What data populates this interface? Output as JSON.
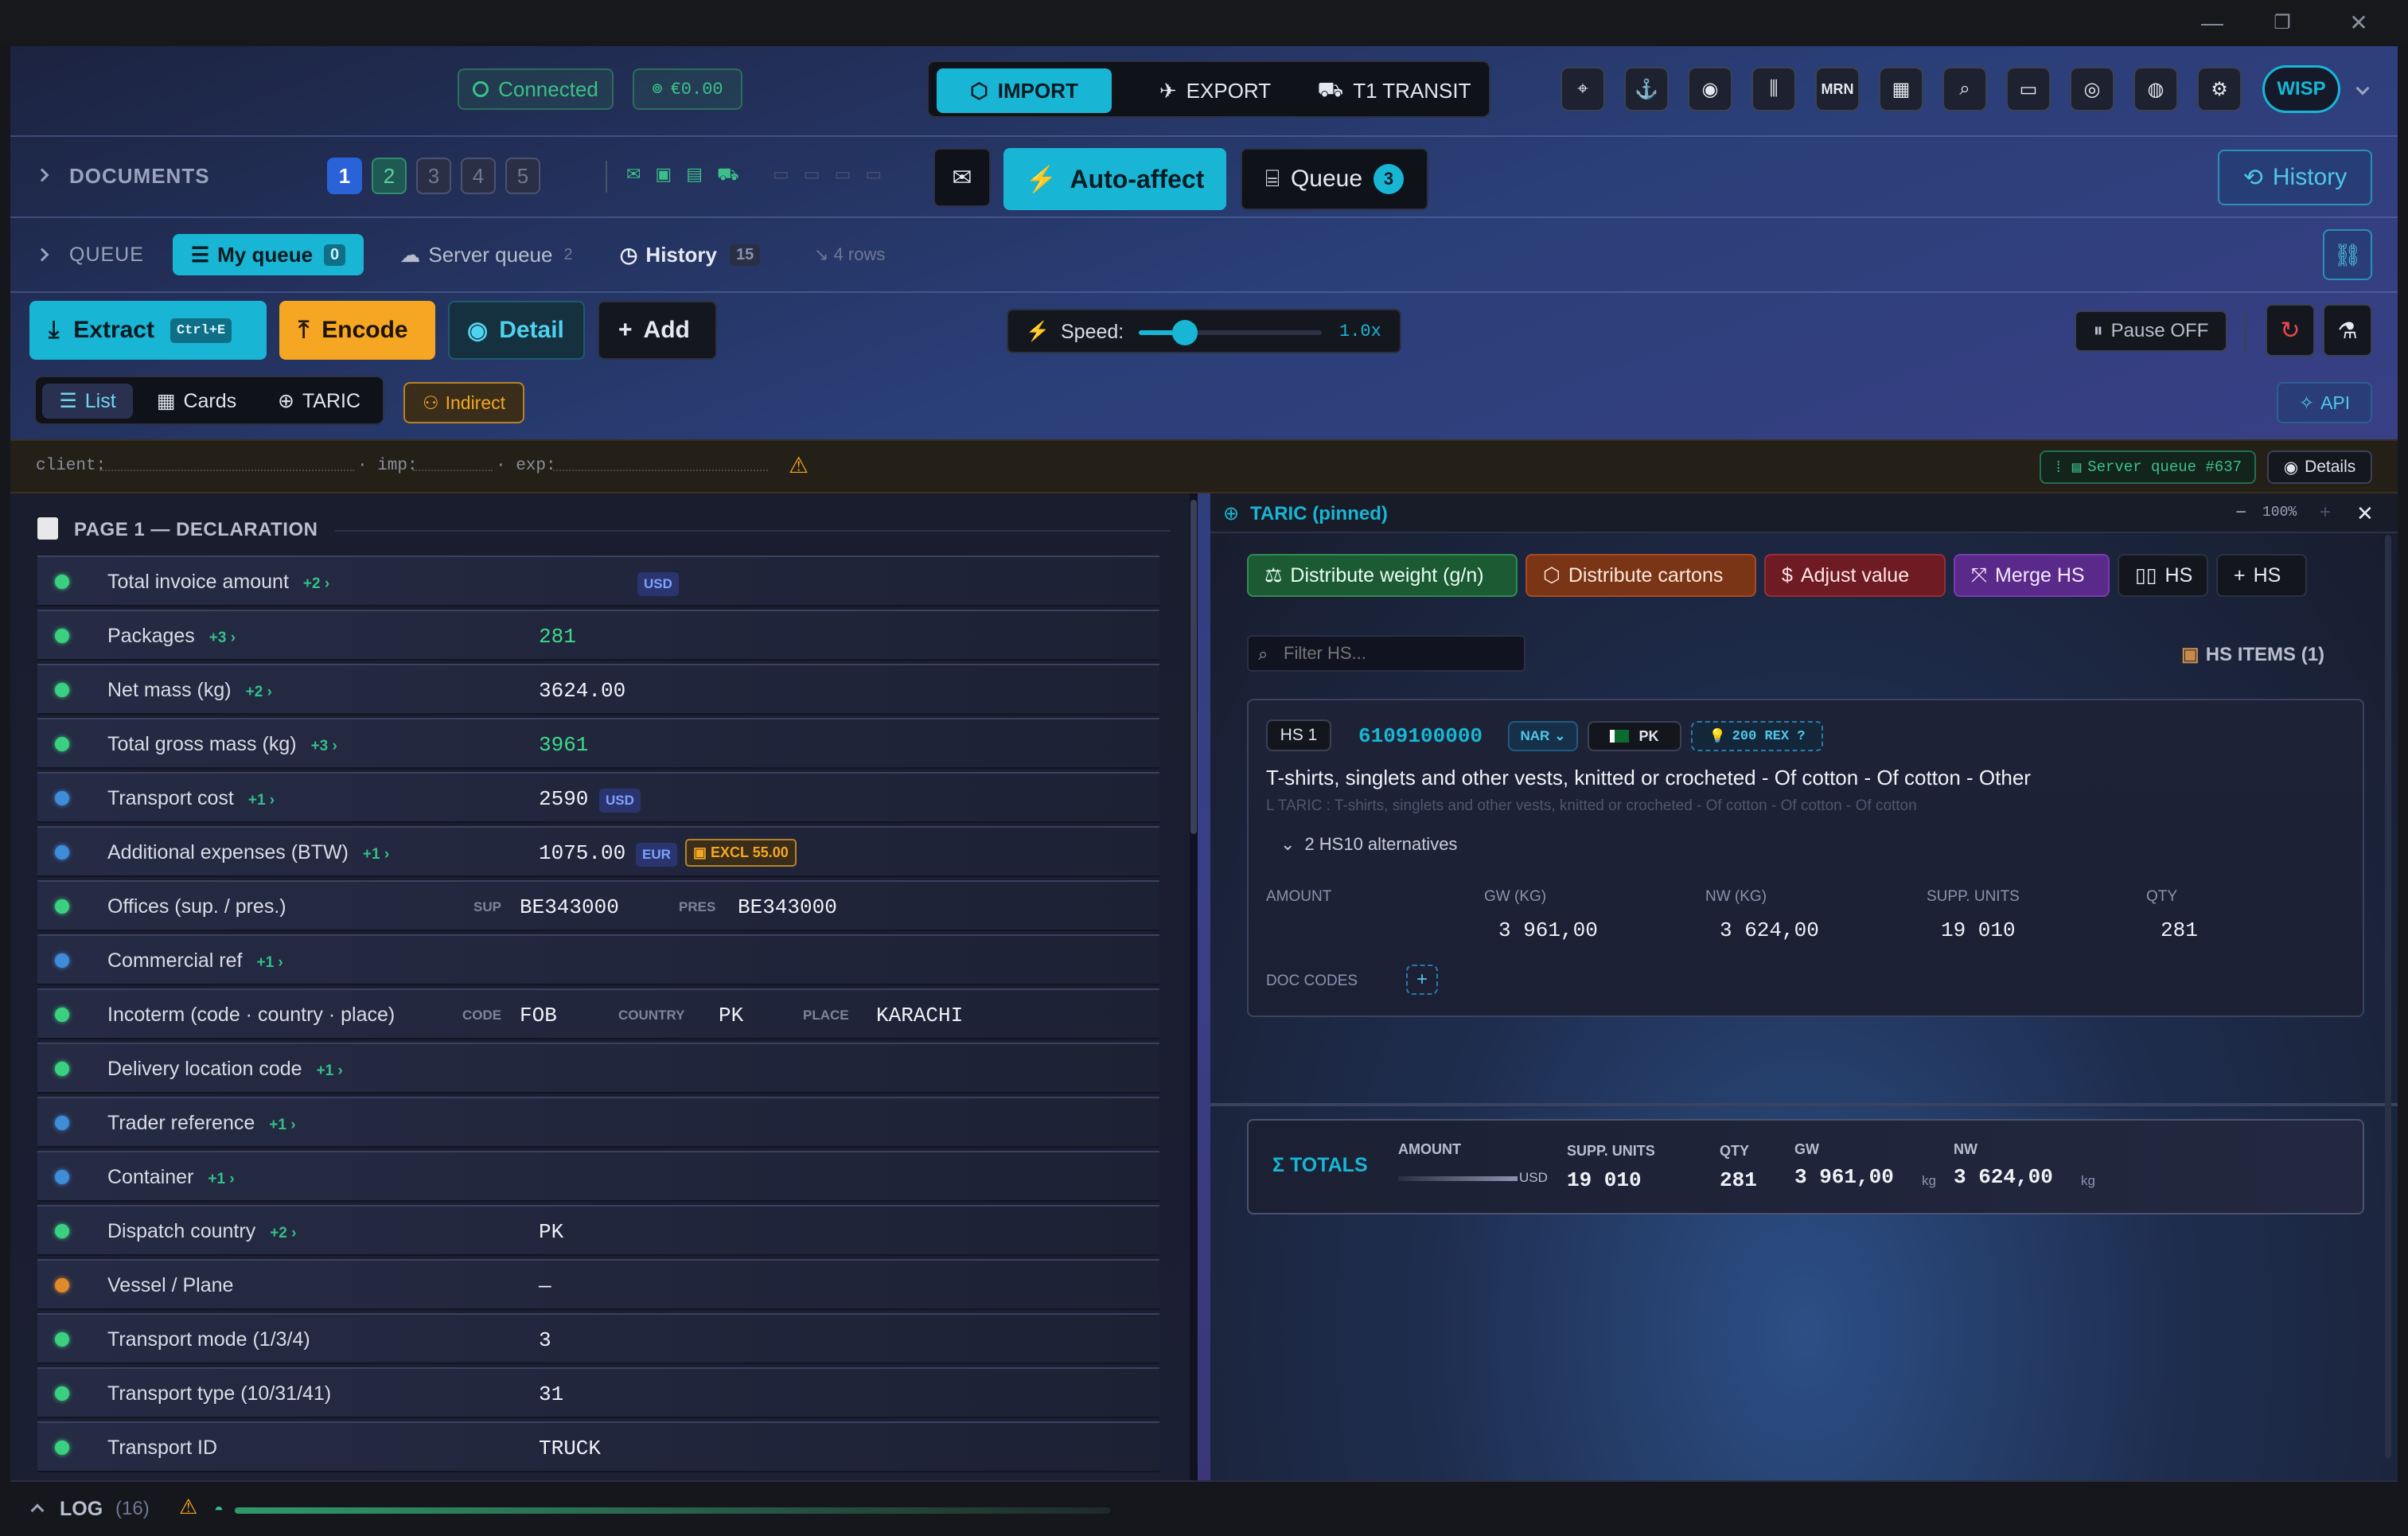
{
  "titlebar": {
    "minimize": "—",
    "restore": "❐",
    "close": "✕"
  },
  "header": {
    "connected": "Connected",
    "balance": "€0.00",
    "modes": [
      "IMPORT",
      "EXPORT",
      "T1 TRANSIT"
    ],
    "icons": [
      "crosshair-icon",
      "hook-icon",
      "eye-icon",
      "columns-icon",
      "mrn-badge",
      "calculator-icon",
      "search-icon",
      "id-card-icon",
      "fingerprint-icon",
      "palette-icon",
      "gear-icon"
    ],
    "mrn": "MRN",
    "user": "WISP"
  },
  "documents": {
    "label": "DOCUMENTS",
    "pages": [
      "1",
      "2",
      "3",
      "4",
      "5"
    ],
    "auto_affect": "Auto-affect",
    "queue": "Queue",
    "queue_count": "3",
    "history": "History"
  },
  "queue_bar": {
    "label": "QUEUE",
    "my_queue": "My queue",
    "my_queue_count": "0",
    "server_queue": "Server queue",
    "server_queue_count": "2",
    "history": "History",
    "history_count": "15",
    "rows": "4 rows"
  },
  "toolbar": {
    "extract": "Extract",
    "extract_shortcut": "Ctrl+E",
    "encode": "Encode",
    "detail": "Detail",
    "add": "Add",
    "speed_label": "Speed:",
    "speed_value": "1.0x",
    "speed_fraction": 0.25,
    "pause": "Pause OFF"
  },
  "view_tabs": {
    "list": "List",
    "cards": "Cards",
    "taric": "TARIC",
    "indirect": "Indirect",
    "api": "API"
  },
  "infobar": {
    "client": "client:",
    "imp": "· imp:",
    "exp": "· exp:",
    "server_queue": "Server queue #637",
    "details": "Details"
  },
  "declaration": {
    "title": "PAGE 1 — DECLARATION",
    "rows": [
      {
        "label": "Total invoice amount",
        "plus": "+2 ›",
        "dot": "#3bd07f",
        "value": "",
        "unit": "USD"
      },
      {
        "label": "Packages",
        "plus": "+3 ›",
        "dot": "#3bd07f",
        "value": "281",
        "green": true
      },
      {
        "label": "Net mass (kg)",
        "plus": "+2 ›",
        "dot": "#3bd07f",
        "value": "3624.00"
      },
      {
        "label": "Total gross mass (kg)",
        "plus": "+3 ›",
        "dot": "#3bd07f",
        "value": "3961",
        "green": true
      },
      {
        "label": "Transport cost",
        "plus": "+1 ›",
        "dot": "#3f8cd8",
        "value": "2590",
        "unit": "USD"
      },
      {
        "label": "Additional expenses (BTW)",
        "plus": "+1 ›",
        "dot": "#3f8cd8",
        "value": "1075.00",
        "unit": "EUR",
        "excl": "EXCL 55.00"
      },
      {
        "label": "Offices (sup. / pres.)",
        "plus": "",
        "dot": "#3bd07f",
        "offices": {
          "sup_label": "SUP",
          "sup": "BE343000",
          "pres_label": "PRES",
          "pres": "BE343000"
        }
      },
      {
        "label": "Commercial ref",
        "plus": "+1 ›",
        "dot": "#3f8cd8",
        "value": ""
      },
      {
        "label": "Incoterm (code · country · place)",
        "plus": "",
        "dot": "#3bd07f",
        "incoterm": {
          "code_label": "CODE",
          "code": "FOB",
          "country_label": "COUNTRY",
          "country": "PK",
          "place_label": "PLACE",
          "place": "KARACHI"
        }
      },
      {
        "label": "Delivery location code",
        "plus": "+1 ›",
        "dot": "#3bd07f",
        "value": ""
      },
      {
        "label": "Trader reference",
        "plus": "+1 ›",
        "dot": "#3f8cd8",
        "value": ""
      },
      {
        "label": "Container",
        "plus": "+1 ›",
        "dot": "#3f8cd8",
        "value": ""
      },
      {
        "label": "Dispatch country",
        "plus": "+2 ›",
        "dot": "#3bd07f",
        "value": "PK"
      },
      {
        "label": "Vessel / Plane",
        "plus": "",
        "dot": "#e08a2a",
        "value": "—"
      },
      {
        "label": "Transport mode (1/3/4)",
        "plus": "",
        "dot": "#3bd07f",
        "value": "3"
      },
      {
        "label": "Transport type (10/31/41)",
        "plus": "",
        "dot": "#3bd07f",
        "value": "31"
      },
      {
        "label": "Transport ID",
        "plus": "",
        "dot": "#3bd07f",
        "value": "TRUCK"
      }
    ]
  },
  "taric": {
    "title": "TARIC (pinned)",
    "zoom": "100%",
    "actions": {
      "distribute_weight": "Distribute weight (g/n)",
      "distribute_cartons": "Distribute cartons",
      "adjust_value": "Adjust value",
      "merge_hs": "Merge HS",
      "hs": "HS",
      "add_hs": "HS"
    },
    "filter_placeholder": "Filter HS...",
    "items_label": "HS ITEMS (1)",
    "item": {
      "hs_label": "HS 1",
      "code": "6109100000",
      "nar": "NAR",
      "country": "PK",
      "rex": "200 REX ?",
      "description": "T-shirts, singlets and other vests, knitted or crocheted - Of cotton - Of cotton - Other",
      "taric_desc": "L TARIC : T-shirts, singlets and other vests, knitted or crocheted - Of cotton - Of cotton - Of cotton",
      "alternatives": "2 HS10 alternatives",
      "col_amount": "AMOUNT",
      "col_gw": "GW (KG)",
      "col_nw": "NW (KG)",
      "col_supp": "SUPP. UNITS",
      "col_qty": "QTY",
      "gw": "3 961,00",
      "nw": "3 624,00",
      "supp": "19 010",
      "qty": "281",
      "doc_codes": "DOC CODES"
    },
    "totals": {
      "label": "Σ TOTALS",
      "amount_label": "AMOUNT",
      "amount_unit": "USD",
      "supp_label": "SUPP. UNITS",
      "supp": "19 010",
      "qty_label": "QTY",
      "qty": "281",
      "gw_label": "GW",
      "gw": "3 961,00",
      "gw_unit": "kg",
      "nw_label": "NW",
      "nw": "3 624,00",
      "nw_unit": "kg"
    }
  },
  "log": {
    "label": "LOG",
    "count": "(16)"
  }
}
